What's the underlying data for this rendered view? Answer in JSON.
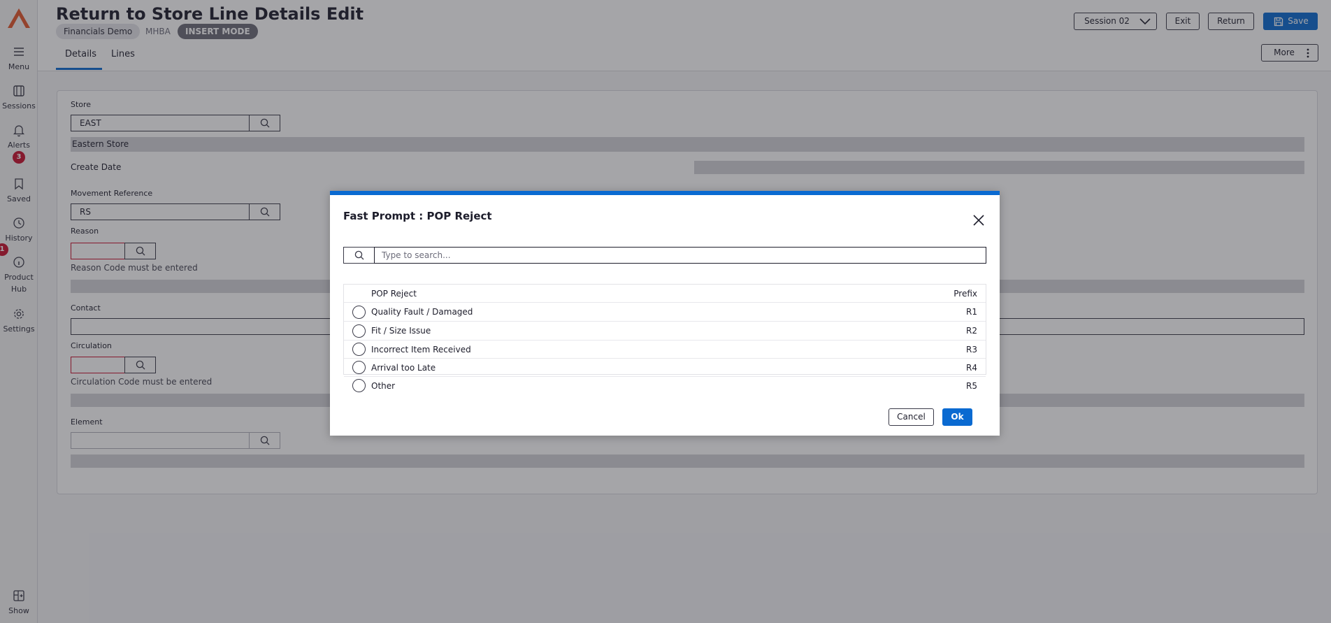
{
  "page": {
    "title": "Return to Store Line Details Edit",
    "chips": {
      "company": "Financials Demo",
      "code": "MHBA",
      "mode": "INSERT MODE"
    },
    "tabs": [
      {
        "label": "Details"
      },
      {
        "label": "Lines"
      }
    ],
    "buttons": {
      "session": "Session 02",
      "exit": "Exit",
      "return": "Return",
      "save": "Save",
      "more": "More"
    }
  },
  "rail": {
    "items": [
      {
        "label": "Menu",
        "icon": "menu-icon"
      },
      {
        "label": "Sessions",
        "icon": "sessions-icon"
      },
      {
        "label": "Alerts",
        "icon": "bell-icon",
        "badge": "3"
      },
      {
        "label": "Saved",
        "icon": "bookmark-icon"
      },
      {
        "label": "History",
        "icon": "clock-icon"
      },
      {
        "label": "Product",
        "label2": "Hub",
        "icon": "info-icon",
        "badge": "1"
      },
      {
        "label": "Settings",
        "icon": "gear-icon"
      },
      {
        "label": "Show",
        "icon": "show-panel-icon"
      }
    ]
  },
  "form": {
    "store": {
      "label": "Store",
      "value": "EAST",
      "description": "Eastern Store"
    },
    "create_date": {
      "label": "Create Date",
      "value": ""
    },
    "movement_reference": {
      "label": "Movement Reference",
      "value": "RS"
    },
    "reason": {
      "label": "Reason",
      "value": "",
      "error": "Reason Code must be entered"
    },
    "contact": {
      "label": "Contact",
      "value": ""
    },
    "circulation": {
      "label": "Circulation",
      "value": "",
      "error": "Circulation Code must be entered"
    },
    "element": {
      "label": "Element",
      "value": ""
    }
  },
  "modal": {
    "title": "Fast Prompt : POP Reject",
    "search_placeholder": "Type to search...",
    "columns": {
      "name": "POP Reject",
      "prefix": "Prefix"
    },
    "rows": [
      {
        "name": "Quality Fault / Damaged",
        "prefix": "R1"
      },
      {
        "name": "Fit / Size Issue",
        "prefix": "R2"
      },
      {
        "name": "Incorrect Item Received",
        "prefix": "R3"
      },
      {
        "name": "Arrival too Late",
        "prefix": "R4"
      },
      {
        "name": "Other",
        "prefix": "R5"
      }
    ],
    "cancel_label": "Cancel",
    "ok_label": "Ok"
  },
  "colors": {
    "accent": "#0a6ad1",
    "error": "#c8102e",
    "logo": "#e2562b"
  }
}
